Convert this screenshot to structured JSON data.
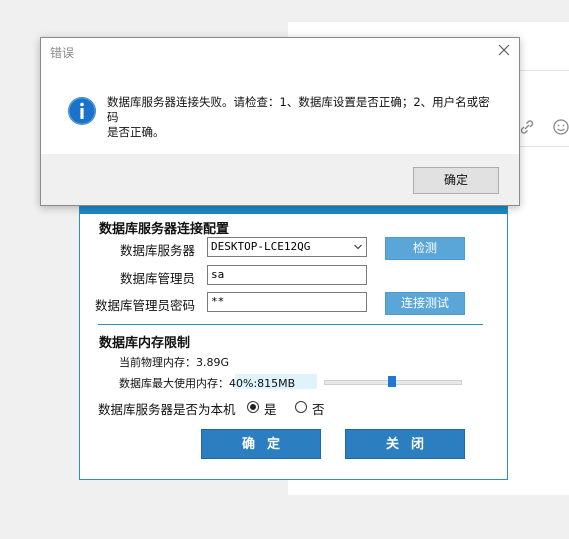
{
  "error_dialog": {
    "title": "错误",
    "message_line1": "数据库服务器连接失败。请检查：1、数据库设置是否正确；2、用户名或密码",
    "message_line2": "是否正确。",
    "ok_label": "确定"
  },
  "config": {
    "section_server": "数据库服务器连接配置",
    "server_label": "数据库服务器",
    "server_value": "DESKTOP-LCE12QG",
    "detect_label": "检测",
    "admin_label": "数据库管理员",
    "admin_value": "sa",
    "password_label": "数据库管理员密码",
    "password_value": "**",
    "test_label": "连接测试",
    "section_memory": "数据库内存限制",
    "physical_mem_label": "当前物理内存：",
    "physical_mem_value": "3.89G",
    "max_mem_label": "数据库最大使用内存：",
    "max_mem_value": "40%:815MB",
    "max_mem_fraction": 0.4,
    "local_label": "数据库服务器是否为本机",
    "yes_label": "是",
    "no_label": "否",
    "local_selected": "yes",
    "confirm_label": "确定",
    "close_label": "关闭"
  },
  "icons": {
    "info": "info-icon",
    "close": "close-icon",
    "dropdown": "chevron-down-icon",
    "link": "link-icon",
    "emoji": "emoji-icon"
  },
  "colors": {
    "accent": "#1f8ac7",
    "button_blue": "#2b7ec0",
    "button_light_blue": "#5aa6d8",
    "info_icon": "#1a73c8"
  }
}
